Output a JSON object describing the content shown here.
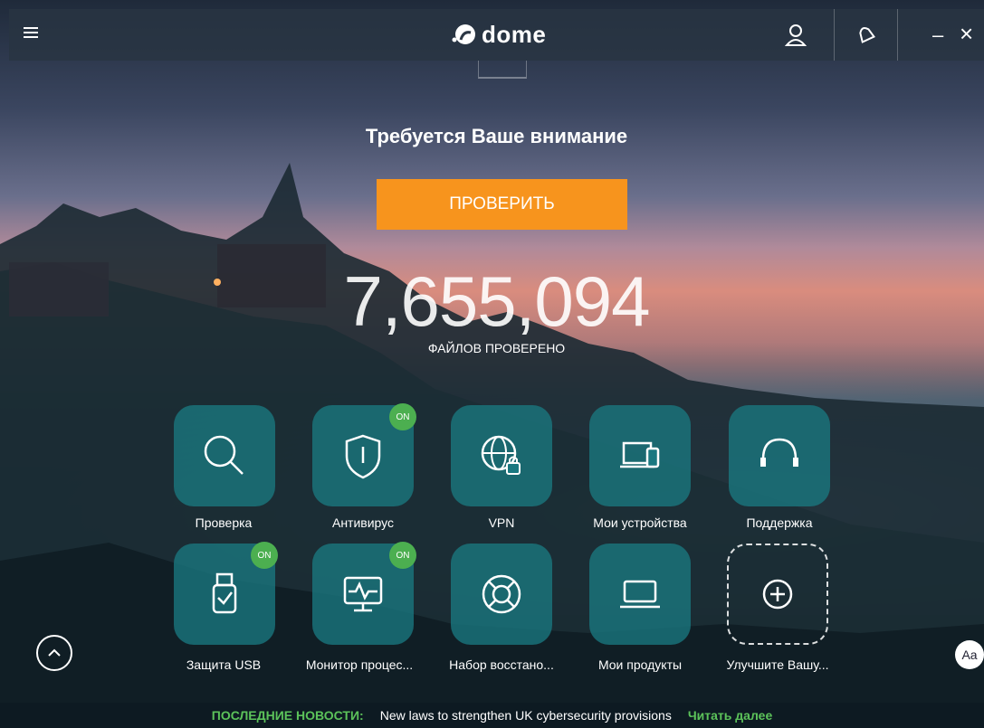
{
  "app": {
    "logo_text": "dome"
  },
  "header": {
    "menu_icon": "hamburger-icon",
    "account_icon": "user-icon",
    "notifications_icon": "bell-icon",
    "minimize_label": "–",
    "close_label": "×"
  },
  "main": {
    "attention_text": "Требуется Ваше внимание",
    "scan_button_label": "ПРОВЕРИТЬ",
    "files_count": "7,655,094",
    "files_label": "ФАЙЛОВ ПРОВЕРЕНО"
  },
  "tiles": [
    {
      "label": "Проверка",
      "icon": "search-icon",
      "badge": ""
    },
    {
      "label": "Антивирус",
      "icon": "shield-icon",
      "badge": "ON"
    },
    {
      "label": "VPN",
      "icon": "globe-lock-icon",
      "badge": ""
    },
    {
      "label": "Мои устройства",
      "icon": "devices-icon",
      "badge": ""
    },
    {
      "label": "Поддержка",
      "icon": "headset-icon",
      "badge": ""
    },
    {
      "label": "Защита USB",
      "icon": "usb-icon",
      "badge": "ON"
    },
    {
      "label": "Монитор процес...",
      "icon": "monitor-pulse-icon",
      "badge": "ON"
    },
    {
      "label": "Набор восстано...",
      "icon": "lifebuoy-icon",
      "badge": ""
    },
    {
      "label": "Мои продукты",
      "icon": "laptop-icon",
      "badge": ""
    },
    {
      "label": "Улучшите Вашу...",
      "icon": "plus-icon",
      "badge": ""
    }
  ],
  "footer": {
    "font_button_label": "Aa",
    "news_label": "ПОСЛЕДНИЕ НОВОСТИ:",
    "news_text": "New laws to strengthen UK cybersecurity provisions",
    "news_more": "Читать далее"
  },
  "colors": {
    "accent": "#f7941d",
    "tile": "#1a7880",
    "badge": "#4caf50",
    "news_link": "#5cc35a"
  }
}
